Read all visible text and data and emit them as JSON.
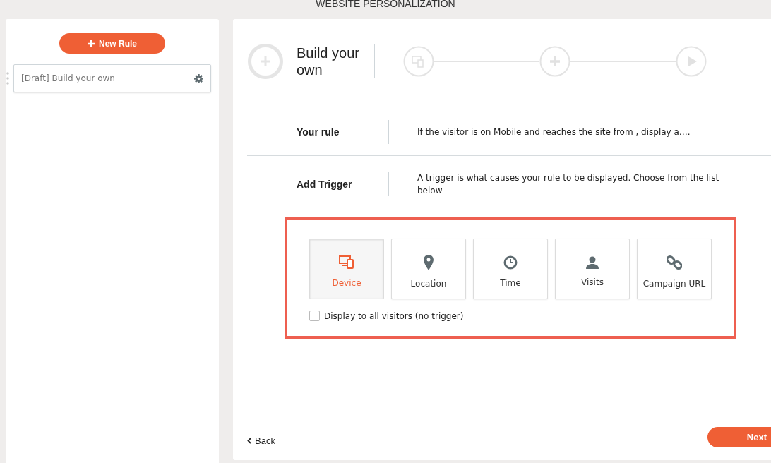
{
  "page_title": "WEBSITE PERSONALIZATION",
  "sidebar": {
    "new_button": {
      "label": "New Rule"
    },
    "rules": [
      {
        "label": "[Draft] Build your own",
        "selected": false
      }
    ]
  },
  "builder": {
    "title": "Build your own",
    "steps": [
      {
        "kind": "device"
      },
      {
        "kind": "plus"
      },
      {
        "kind": "play"
      }
    ],
    "rows": [
      {
        "label": "Your rule",
        "text": "If the visitor is on Mobile and reaches the site from , display a…."
      },
      {
        "label": "Add Trigger",
        "text": "A trigger is what causes your rule to be displayed. Choose from the list below"
      }
    ],
    "triggers": [
      {
        "kind": "device",
        "label": "Device",
        "selected": true
      },
      {
        "kind": "location",
        "label": "Location",
        "selected": false
      },
      {
        "kind": "time",
        "label": "Time",
        "selected": false
      },
      {
        "kind": "visits",
        "label": "Visits",
        "selected": false
      },
      {
        "kind": "link",
        "label": "Campaign URL",
        "selected": false
      }
    ],
    "all_visitors": {
      "label": "Display to all visitors (no trigger)",
      "checked": false
    },
    "back": "Back",
    "next": "Next"
  }
}
